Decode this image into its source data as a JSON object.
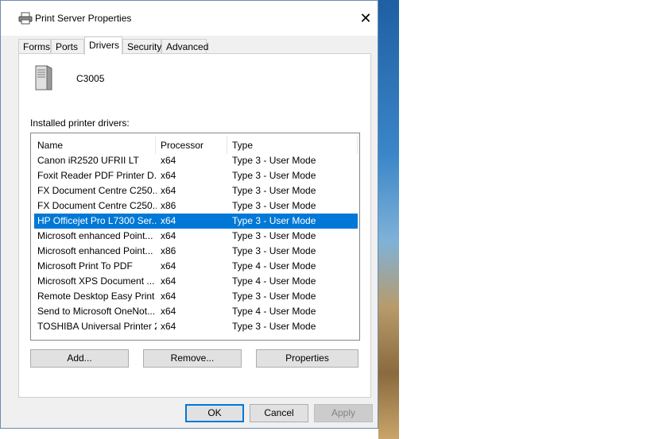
{
  "window": {
    "title": "Print Server Properties",
    "close_glyph": "✕"
  },
  "tabs": [
    {
      "label": "Forms"
    },
    {
      "label": "Ports"
    },
    {
      "label": "Drivers"
    },
    {
      "label": "Security"
    },
    {
      "label": "Advanced"
    }
  ],
  "active_tab": "Drivers",
  "server": {
    "name": "C3005"
  },
  "list_label": "Installed printer drivers:",
  "columns": {
    "name": "Name",
    "processor": "Processor",
    "type": "Type"
  },
  "drivers": [
    {
      "name": "Canon iR2520 UFRII LT",
      "processor": "x64",
      "type": "Type 3 - User Mode"
    },
    {
      "name": "Foxit Reader PDF Printer D...",
      "processor": "x64",
      "type": "Type 3 - User Mode"
    },
    {
      "name": "FX Document Centre C250...",
      "processor": "x64",
      "type": "Type 3 - User Mode"
    },
    {
      "name": "FX Document Centre C250...",
      "processor": "x86",
      "type": "Type 3 - User Mode"
    },
    {
      "name": "HP Officejet Pro L7300 Ser...",
      "processor": "x64",
      "type": "Type 3 - User Mode"
    },
    {
      "name": "Microsoft enhanced Point...",
      "processor": "x64",
      "type": "Type 3 - User Mode"
    },
    {
      "name": "Microsoft enhanced Point...",
      "processor": "x86",
      "type": "Type 3 - User Mode"
    },
    {
      "name": "Microsoft Print To PDF",
      "processor": "x64",
      "type": "Type 4 - User Mode"
    },
    {
      "name": "Microsoft XPS Document ...",
      "processor": "x64",
      "type": "Type 4 - User Mode"
    },
    {
      "name": "Remote Desktop Easy Print",
      "processor": "x64",
      "type": "Type 3 - User Mode"
    },
    {
      "name": "Send to Microsoft OneNot...",
      "processor": "x64",
      "type": "Type 4 - User Mode"
    },
    {
      "name": "TOSHIBA Universal Printer 2",
      "processor": "x64",
      "type": "Type 3 - User Mode"
    }
  ],
  "selected_driver_index": 4,
  "buttons": {
    "add": "Add...",
    "remove": "Remove...",
    "properties": "Properties"
  },
  "footer": {
    "ok": "OK",
    "cancel": "Cancel",
    "apply": "Apply"
  },
  "colors": {
    "selection": "#0078d7",
    "accent": "#0078d7"
  },
  "icons": {
    "title": "printer-icon",
    "server": "server-tower-icon",
    "close": "close-icon"
  }
}
